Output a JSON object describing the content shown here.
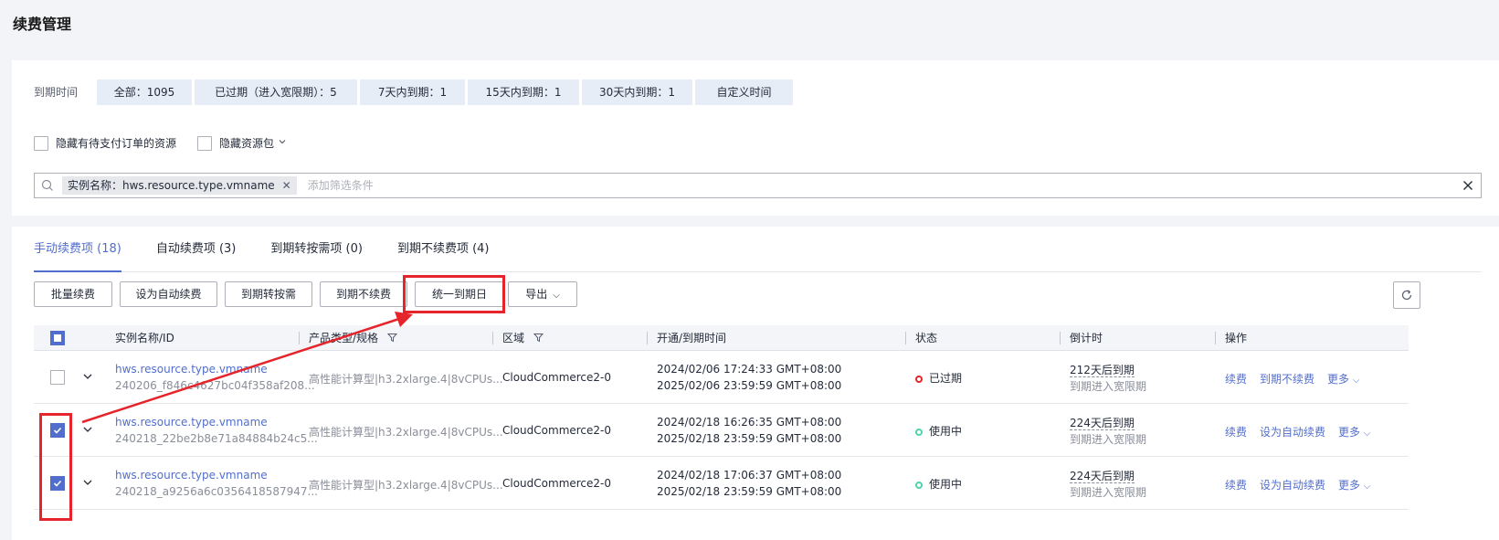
{
  "page": {
    "title": "续费管理"
  },
  "filter": {
    "label": "到期时间",
    "tabs": [
      {
        "label": "全部：1095"
      },
      {
        "label": "已过期（进入宽限期）：5"
      },
      {
        "label": "7天内到期：1"
      },
      {
        "label": "15天内到期：1"
      },
      {
        "label": "30天内到期：1"
      },
      {
        "label": "自定义时间"
      }
    ]
  },
  "options": {
    "hide_pending": "隐藏有待支付订单的资源",
    "hide_package": "隐藏资源包"
  },
  "search": {
    "chip": "实例名称：hws.resource.type.vmname",
    "placeholder": "添加筛选条件"
  },
  "tabs": [
    {
      "label": "手动续费项 (18)",
      "active": true
    },
    {
      "label": "自动续费项 (3)"
    },
    {
      "label": "到期转按需项 (0)"
    },
    {
      "label": "到期不续费项 (4)"
    }
  ],
  "toolbar": {
    "batch_renew": "批量续费",
    "set_auto": "设为自动续费",
    "to_on_demand": "到期转按需",
    "no_renew": "到期不续费",
    "unify_date": "统一到期日",
    "export": "导出"
  },
  "table": {
    "headers": {
      "name": "实例名称/ID",
      "product": "产品类型/规格",
      "region": "区域",
      "time": "开通/到期时间",
      "status": "状态",
      "countdown": "倒计时",
      "ops": "操作"
    },
    "rows": [
      {
        "checked": false,
        "name": "hws.resource.type.vmname",
        "id": "240206_f846c4627bc04f358af208...",
        "product": "高性能计算型|h3.2xlarge.4|8vCPUs...",
        "region": "CloudCommerce2-0",
        "open_time": "2024/02/06 17:24:33 GMT+08:00",
        "expire_time": "2025/02/06 23:59:59 GMT+08:00",
        "status": "已过期",
        "status_color": "#e5242b",
        "countdown": "212天后到期",
        "countdown_sub": "到期进入宽限期",
        "op1": "续费",
        "op2": "到期不续费",
        "op3": "更多"
      },
      {
        "checked": true,
        "name": "hws.resource.type.vmname",
        "id": "240218_22be2b8e71a84884b24c5...",
        "product": "高性能计算型|h3.2xlarge.4|8vCPUs...",
        "region": "CloudCommerce2-0",
        "open_time": "2024/02/18 16:26:35 GMT+08:00",
        "expire_time": "2025/02/18 23:59:59 GMT+08:00",
        "status": "使用中",
        "status_color": "#50d4ab",
        "countdown": "224天后到期",
        "countdown_sub": "到期进入宽限期",
        "op1": "续费",
        "op2": "设为自动续费",
        "op3": "更多"
      },
      {
        "checked": true,
        "name": "hws.resource.type.vmname",
        "id": "240218_a9256a6c0356418587947...",
        "product": "高性能计算型|h3.2xlarge.4|8vCPUs...",
        "region": "CloudCommerce2-0",
        "open_time": "2024/02/18 17:06:37 GMT+08:00",
        "expire_time": "2025/02/18 23:59:59 GMT+08:00",
        "status": "使用中",
        "status_color": "#50d4ab",
        "countdown": "224天后到期",
        "countdown_sub": "到期进入宽限期",
        "op1": "续费",
        "op2": "设为自动续费",
        "op3": "更多"
      }
    ]
  },
  "colors": {
    "accent": "#526ecc",
    "highlight": "#e5242b"
  }
}
